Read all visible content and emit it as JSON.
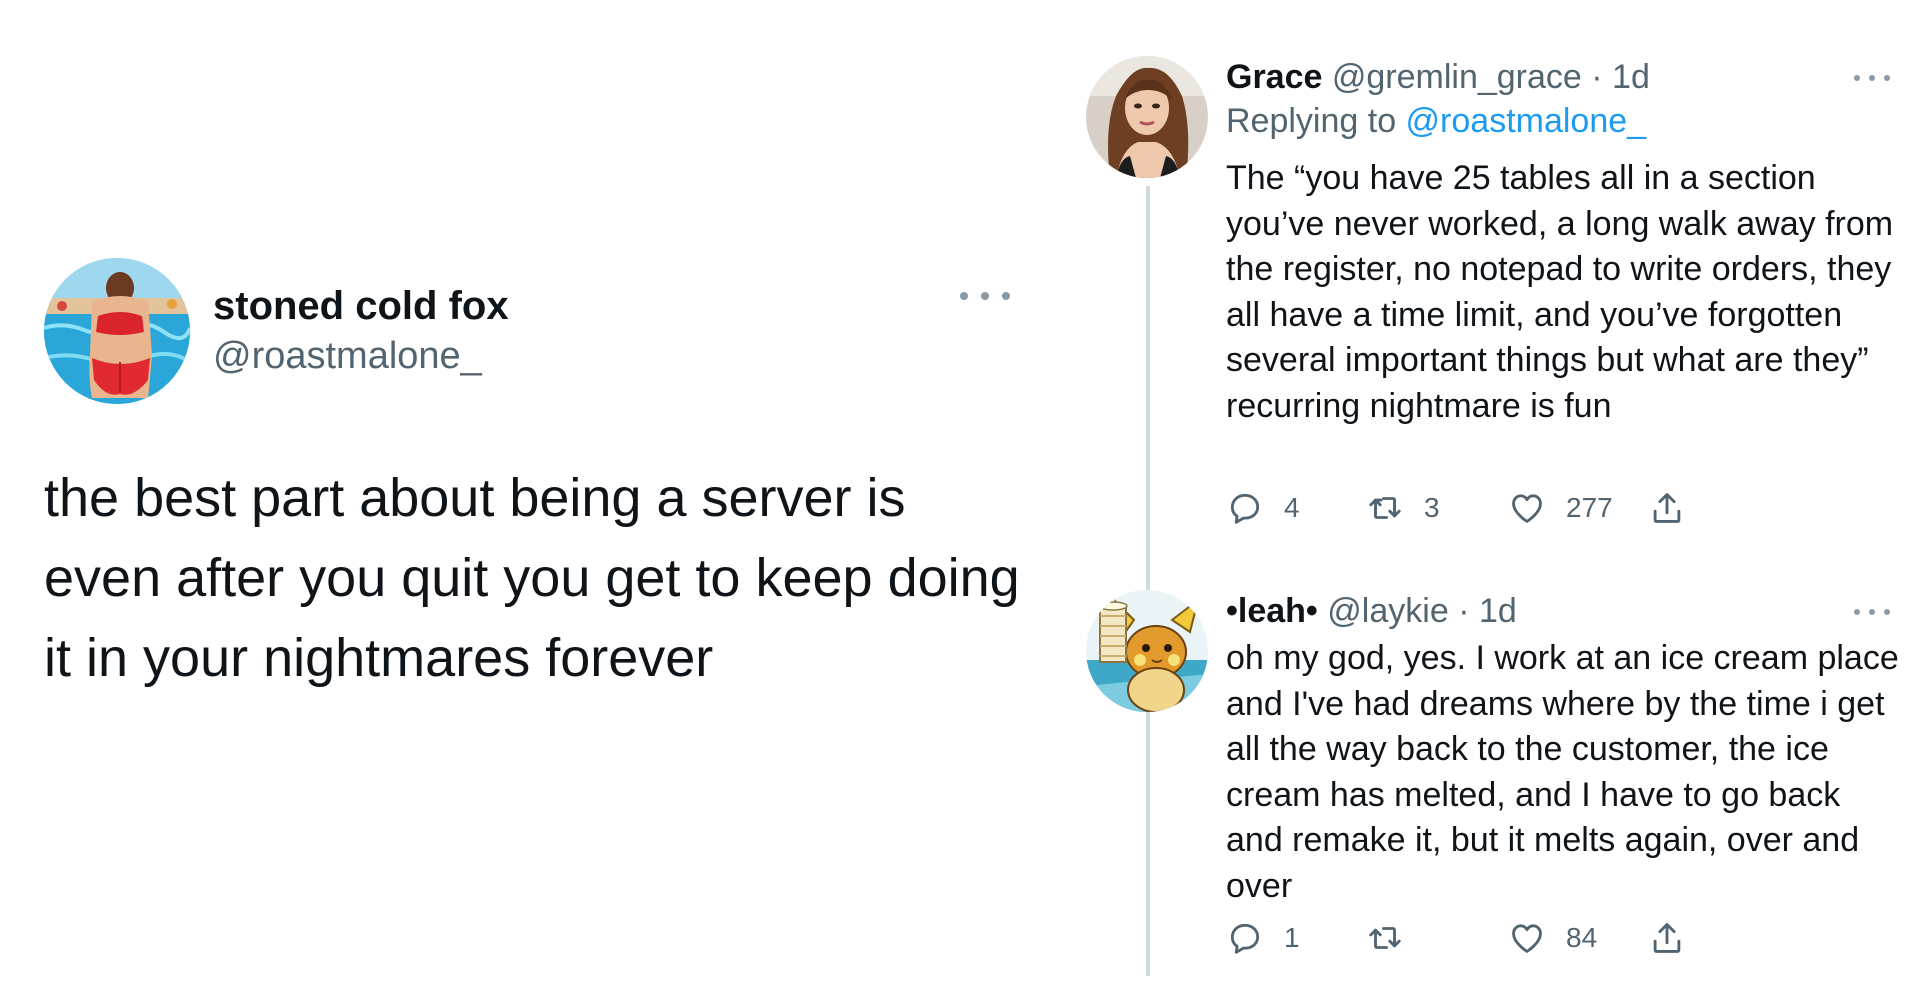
{
  "main_tweet": {
    "display_name": "stoned cold fox",
    "handle": "@roastmalone_",
    "text": "the best part about being a server is even after you quit you get to keep doing it in your nightmares forever",
    "avatar_icon": "pool-photo-avatar"
  },
  "replies": [
    {
      "display_name": "Grace",
      "handle": "@gremlin_grace",
      "separator": "·",
      "time": "1d",
      "replying_prefix": "Replying to ",
      "replying_to": "@roastmalone_",
      "text": "The “you have 25 tables all in a section you’ve never worked, a long walk away from the register, no notepad to write orders, they all have a time limit, and you’ve forgotten several important things but what are they” recurring nightmare is fun",
      "replies_count": "4",
      "retweets_count": "3",
      "likes_count": "277",
      "avatar_icon": "portrait-photo-avatar"
    },
    {
      "display_name": "•leah•",
      "handle": "@laykie",
      "separator": "·",
      "time": "1d",
      "text": "oh my god, yes. I work at an ice cream place and I've had dreams where by the time i get all the way back to the customer, the ice cream has melted, and I have to go back and remake it, but it melts again, over and over",
      "replies_count": "1",
      "retweets_count": "",
      "likes_count": "84",
      "avatar_icon": "raichu-cartoon-avatar"
    }
  ],
  "colors": {
    "text": "#0f1419",
    "secondary": "#536471",
    "link": "#1d9bf0",
    "thread_line": "#cfd9de"
  }
}
